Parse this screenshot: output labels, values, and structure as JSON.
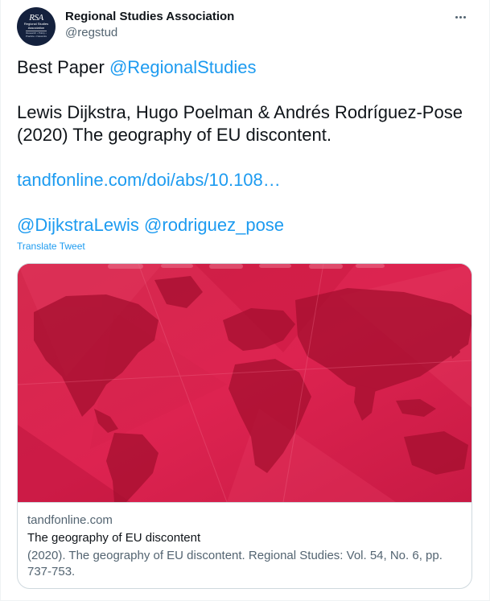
{
  "author": {
    "display_name": "Regional Studies Association",
    "handle": "@regstud",
    "avatar_logo": "RSA",
    "avatar_subtitle": "Regional Studies Association",
    "avatar_tagline": "Research • Policy • Practice • Networks"
  },
  "more_icon": "more-horizontal-icon",
  "tweet": {
    "line1_prefix": "Best Paper ",
    "line1_mention": "@RegionalStudies",
    "line2": "Lewis Dijkstra, Hugo Poelman & Andrés Rodríguez-Pose (2020) The geography of EU discontent.",
    "link": "tandfonline.com/doi/abs/10.108…",
    "mention1": "@DijkstraLewis",
    "mention2": "@rodriguez_pose"
  },
  "translate_label": "Translate Tweet",
  "card": {
    "domain": "tandfonline.com",
    "title": "The geography of EU discontent",
    "description": "(2020). The geography of EU discontent. Regional Studies: Vol. 54, No. 6, pp. 737-753.",
    "image_description": "red-world-map"
  },
  "colors": {
    "link": "#1d9bf0",
    "card_image_bg": "#d81e48",
    "text": "#0f1419",
    "secondary": "#536471"
  }
}
